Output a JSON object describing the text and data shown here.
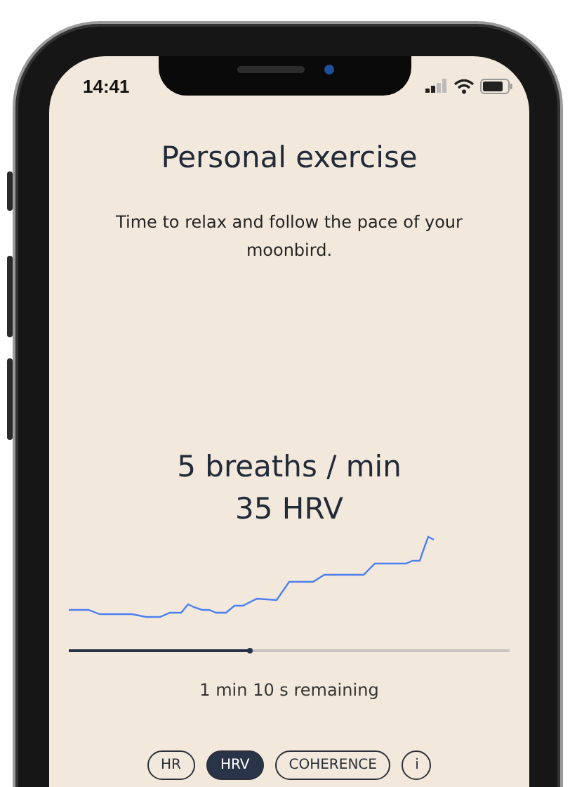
{
  "status_bar": {
    "time": "14:41"
  },
  "title": "Personal exercise",
  "subtitle": "Time to relax and follow the pace of your moonbird.",
  "breathing_rate": "5 breaths / min",
  "hrv_value": "35 HRV",
  "progress": {
    "level": 0.41
  },
  "remaining": "1 min 10 s remaining",
  "tabs": [
    {
      "label": "HR",
      "selected": false
    },
    {
      "label": "HRV",
      "selected": true
    },
    {
      "label": "COHERENCE",
      "selected": false
    }
  ],
  "info_button": "i"
}
